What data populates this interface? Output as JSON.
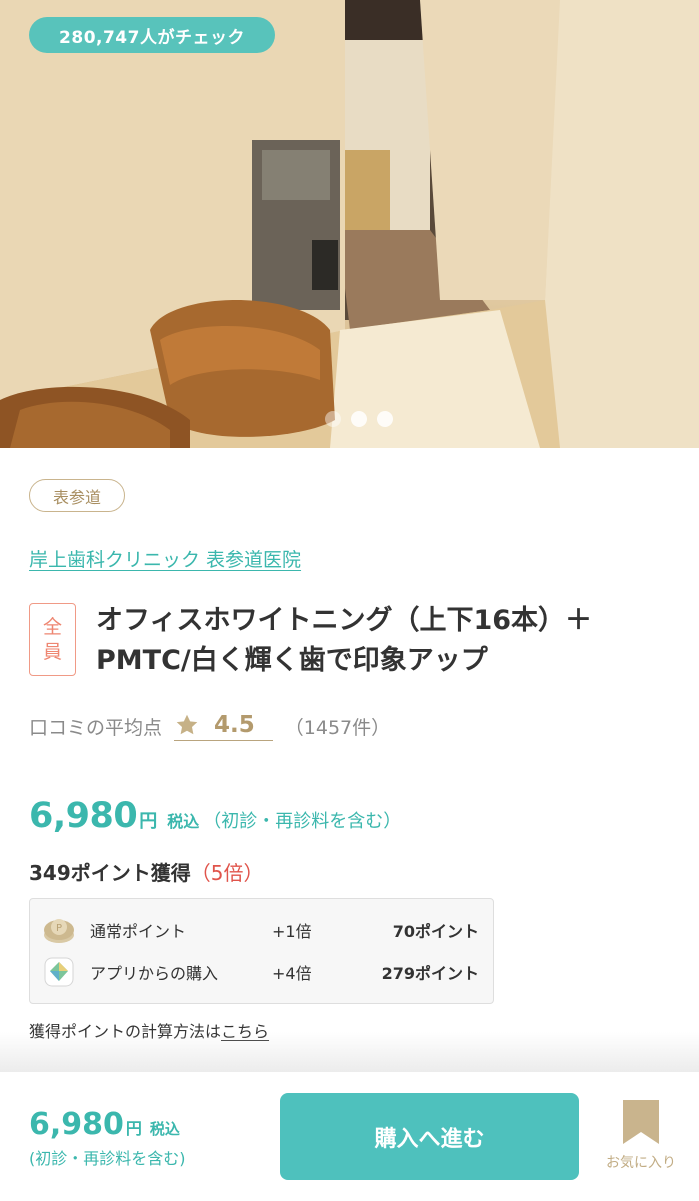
{
  "hero": {
    "view_count_badge": "280,747人がチェック",
    "carousel_total": 3,
    "carousel_active_index": 0
  },
  "area_tag": "表参道",
  "clinic_name": "岸上歯科クリニック 表参道医院",
  "gender_label": [
    "全",
    "員"
  ],
  "title_line1": "オフィスホワイトニング（上下16本）＋",
  "title_line2": "PMTC/白く輝く歯で印象アップ",
  "rating": {
    "label": "口コミの平均点",
    "value": "4.5",
    "count": "（1457件）"
  },
  "price": {
    "amount": "6,980",
    "unit": "円",
    "tax": "税込",
    "note": "（初診・再診料を含む）"
  },
  "points": {
    "earned_text": "349ポイント獲得",
    "multiplier_text": "（5倍）",
    "rows": [
      {
        "icon": "coin-icon",
        "label": "通常ポイント",
        "rate": "+1倍",
        "points": "70ポイント"
      },
      {
        "icon": "app-icon",
        "label": "アプリからの購入",
        "rate": "+4倍",
        "points": "279ポイント"
      }
    ],
    "calc_text": "獲得ポイントの計算方法は",
    "calc_link": "こちら"
  },
  "bottom_bar": {
    "price": "6,980",
    "unit": "円",
    "tax": "税込",
    "note": "(初診・再診料を含む)",
    "buy_button": "購入へ進む",
    "favorite_label": "お気に入り"
  },
  "colors": {
    "accent_teal": "#3bb7ad",
    "button_teal": "#4ec1bd",
    "gold": "#b39a6d",
    "gender_red": "#ee8671",
    "multiplier_red": "#e0544b"
  }
}
